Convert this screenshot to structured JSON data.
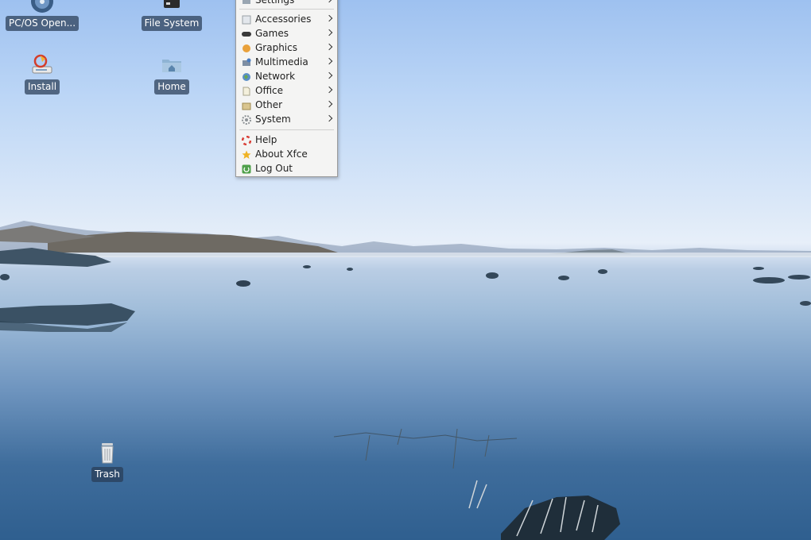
{
  "desktop": {
    "icons": [
      {
        "label": "PC/OS Open..."
      },
      {
        "label": "File System"
      },
      {
        "label": "Install"
      },
      {
        "label": "Home"
      },
      {
        "label": "Trash"
      }
    ]
  },
  "menu": {
    "items": [
      {
        "label": "Settings",
        "icon": "settings-icon",
        "submenu": true
      },
      {
        "label": "Accessories",
        "icon": "accessories-icon",
        "submenu": true
      },
      {
        "label": "Games",
        "icon": "gamepad-icon",
        "submenu": true
      },
      {
        "label": "Graphics",
        "icon": "paintbrush-icon",
        "submenu": true
      },
      {
        "label": "Multimedia",
        "icon": "multimedia-icon",
        "submenu": true
      },
      {
        "label": "Network",
        "icon": "globe-icon",
        "submenu": true
      },
      {
        "label": "Office",
        "icon": "document-icon",
        "submenu": true
      },
      {
        "label": "Other",
        "icon": "other-icon",
        "submenu": true
      },
      {
        "label": "System",
        "icon": "gear-icon",
        "submenu": true
      },
      {
        "label": "Help",
        "icon": "lifebuoy-icon",
        "submenu": false
      },
      {
        "label": "About Xfce",
        "icon": "star-icon",
        "submenu": false
      },
      {
        "label": "Log Out",
        "icon": "logout-icon",
        "submenu": false
      }
    ]
  }
}
